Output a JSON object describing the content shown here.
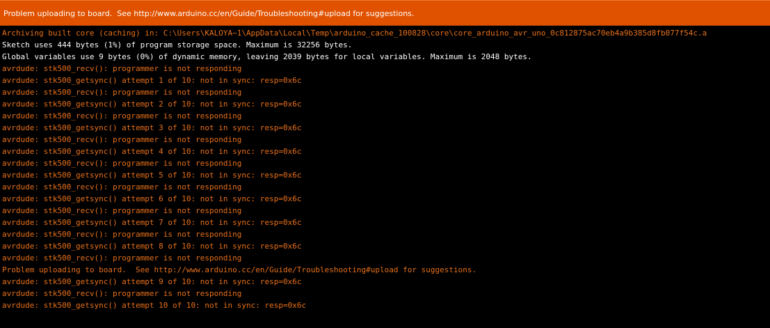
{
  "status_bar": {
    "message": "Problem uploading to board.  See http://www.arduino.cc/en/Guide/Troubleshooting#upload for suggestions.",
    "color": "#e05200"
  },
  "console": {
    "colors": {
      "error": "#e8701a",
      "info": "#ffffff"
    },
    "lines": [
      {
        "type": "error",
        "text": "Archiving built core (caching) in: C:\\Users\\KALOYA~1\\AppData\\Local\\Temp\\arduino_cache_100828\\core\\core_arduino_avr_uno_0c812875ac70eb4a9b385d8fb077f54c.a"
      },
      {
        "type": "info",
        "text": "Sketch uses 444 bytes (1%) of program storage space. Maximum is 32256 bytes."
      },
      {
        "type": "info",
        "text": "Global variables use 9 bytes (0%) of dynamic memory, leaving 2039 bytes for local variables. Maximum is 2048 bytes."
      },
      {
        "type": "error",
        "text": "avrdude: stk500_recv(): programmer is not responding"
      },
      {
        "type": "error",
        "text": "avrdude: stk500_getsync() attempt 1 of 10: not in sync: resp=0x6c"
      },
      {
        "type": "error",
        "text": "avrdude: stk500_recv(): programmer is not responding"
      },
      {
        "type": "error",
        "text": "avrdude: stk500_getsync() attempt 2 of 10: not in sync: resp=0x6c"
      },
      {
        "type": "error",
        "text": "avrdude: stk500_recv(): programmer is not responding"
      },
      {
        "type": "error",
        "text": "avrdude: stk500_getsync() attempt 3 of 10: not in sync: resp=0x6c"
      },
      {
        "type": "error",
        "text": "avrdude: stk500_recv(): programmer is not responding"
      },
      {
        "type": "error",
        "text": "avrdude: stk500_getsync() attempt 4 of 10: not in sync: resp=0x6c"
      },
      {
        "type": "error",
        "text": "avrdude: stk500_recv(): programmer is not responding"
      },
      {
        "type": "error",
        "text": "avrdude: stk500_getsync() attempt 5 of 10: not in sync: resp=0x6c"
      },
      {
        "type": "error",
        "text": "avrdude: stk500_recv(): programmer is not responding"
      },
      {
        "type": "error",
        "text": "avrdude: stk500_getsync() attempt 6 of 10: not in sync: resp=0x6c"
      },
      {
        "type": "error",
        "text": "avrdude: stk500_recv(): programmer is not responding"
      },
      {
        "type": "error",
        "text": "avrdude: stk500_getsync() attempt 7 of 10: not in sync: resp=0x6c"
      },
      {
        "type": "error",
        "text": "avrdude: stk500_recv(): programmer is not responding"
      },
      {
        "type": "error",
        "text": "avrdude: stk500_getsync() attempt 8 of 10: not in sync: resp=0x6c"
      },
      {
        "type": "error",
        "text": "avrdude: stk500_recv(): programmer is not responding"
      },
      {
        "type": "error",
        "text": "Problem uploading to board.  See http://www.arduino.cc/en/Guide/Troubleshooting#upload for suggestions."
      },
      {
        "type": "error",
        "text": "avrdude: stk500_getsync() attempt 9 of 10: not in sync: resp=0x6c"
      },
      {
        "type": "error",
        "text": "avrdude: stk500_recv(): programmer is not responding"
      },
      {
        "type": "error",
        "text": "avrdude: stk500_getsync() attempt 10 of 10: not in sync: resp=0x6c"
      }
    ]
  }
}
